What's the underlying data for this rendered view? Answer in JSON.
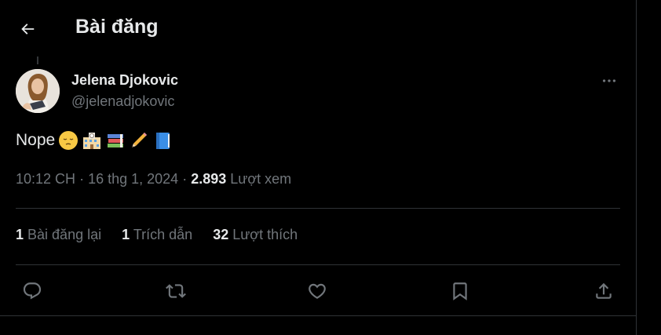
{
  "header": {
    "title": "Bài đăng"
  },
  "post": {
    "author_name": "Jelena Djokovic",
    "author_handle": "@jelenadjokovic",
    "text": "Nope",
    "emojis": [
      "pensive-face",
      "school-building",
      "books",
      "pencil",
      "blue-book"
    ],
    "time": "10:12 CH",
    "separator": "·",
    "date": "16 thg 1, 2024",
    "views_count": "2.893",
    "views_label": "Lượt xem"
  },
  "stats": {
    "reposts_count": "1",
    "reposts_label": "Bài đăng lại",
    "quotes_count": "1",
    "quotes_label": "Trích dẫn",
    "likes_count": "32",
    "likes_label": "Lượt thích"
  },
  "colors": {
    "background": "#000000",
    "text_primary": "#e7e9ea",
    "text_secondary": "#71767b",
    "divider": "#2f3336"
  },
  "icons": [
    "back-arrow-icon",
    "more-icon",
    "reply-icon",
    "repost-icon",
    "like-icon",
    "bookmark-icon",
    "share-icon"
  ]
}
